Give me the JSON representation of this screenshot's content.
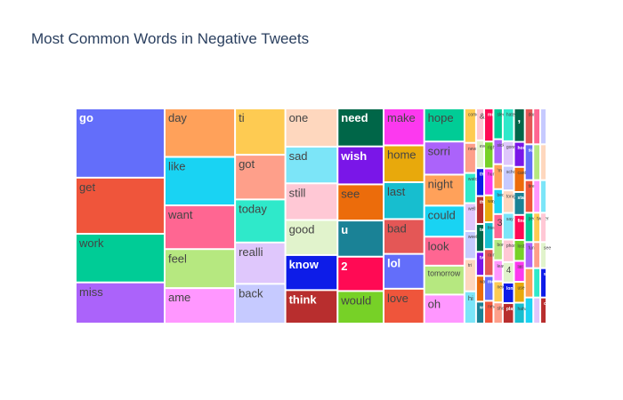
{
  "chart_data": {
    "type": "treemap",
    "title": "Most Common Words in Negative Tweets",
    "columns": [
      {
        "words": [
          "go",
          "get",
          "work",
          "miss"
        ],
        "values": [
          74,
          60,
          52,
          44
        ]
      },
      {
        "words": [
          "day",
          "like",
          "want",
          "feel",
          "ame"
        ],
        "values": [
          41,
          41,
          37,
          33,
          30
        ]
      },
      {
        "words": [
          "ti",
          "got",
          "today",
          "realli",
          "back"
        ],
        "values": [
          28,
          27,
          26,
          25,
          24
        ]
      },
      {
        "words": [
          "one",
          "sad",
          "still",
          "good",
          "know",
          "think"
        ],
        "values": [
          24,
          23,
          23,
          22,
          22,
          21
        ]
      },
      {
        "words": [
          "need",
          "wish",
          "see",
          "u",
          "2",
          "would"
        ],
        "values": [
          21,
          21,
          20,
          20,
          19,
          18
        ]
      },
      {
        "words": [
          "make",
          "home",
          "last",
          "bad",
          "lol",
          "love"
        ],
        "values": [
          18,
          18,
          18,
          17,
          17,
          17
        ]
      },
      {
        "words": [
          "hope",
          "sorri",
          "night",
          "could",
          "look",
          "tomorrow",
          "oh"
        ],
        "values": [
          16,
          16,
          15,
          15,
          14,
          14,
          14
        ]
      }
    ],
    "grid": {
      "col_values": [
        30,
        21,
        24,
        24,
        29,
        28,
        22,
        18,
        16
      ],
      "cells": [
        [
          {
            "w": "come",
            "v": 8
          },
          {
            "w": "new",
            "v": 7
          },
          {
            "w": "watch",
            "v": 7
          },
          {
            "w": "well",
            "v": 6.5
          },
          {
            "w": "week",
            "v": 6.5
          },
          {
            "w": "tri",
            "v": 7.5
          },
          {
            "w": "hi",
            "v": 7.5
          }
        ],
        [
          {
            "w": "&",
            "v": 8
          },
          {
            "w": "even",
            "v": 7
          },
          {
            "w": "thing",
            "v": 7
          },
          {
            "w": "though",
            "v": 7
          },
          {
            "w": "take",
            "v": 7
          },
          {
            "w": "twitter",
            "v": 6
          },
          {
            "w": "wait",
            "v": 6.5
          },
          {
            "w": "wanna",
            "v": 5.5
          }
        ],
        [
          {
            "w": "much",
            "v": 8
          },
          {
            "w": "right",
            "v": 6.5
          },
          {
            "w": "hurt",
            "v": 6.5
          },
          {
            "w": "way",
            "v": 6.5
          },
          {
            "w": "friend",
            "v": 6.5
          },
          {
            "w": "rain",
            "v": 6.5
          },
          {
            "w": "morn",
            "v": 6
          },
          {
            "w": "never",
            "v": 5.5
          }
        ],
        [
          {
            "w": "sleep",
            "v": 8
          },
          {
            "w": "sick",
            "v": 6.5
          },
          {
            "w": "'m",
            "v": 6.5
          },
          {
            "w": "bed",
            "v": 6.5
          },
          {
            "w": "3",
            "v": 6.5
          },
          {
            "w": "bore",
            "v": 5.5
          },
          {
            "w": "leav",
            "v": 5.5
          },
          {
            "w": "next",
            "v": 5.5
          },
          {
            "w": "show",
            "v": 5.5
          }
        ],
        [
          {
            "w": "hate",
            "v": 8
          },
          {
            "w": "gonna",
            "v": 6
          },
          {
            "w": "school",
            "v": 6
          },
          {
            "w": "tonight",
            "v": 5.5
          },
          {
            "w": "say",
            "v": 6.5
          },
          {
            "w": "phone",
            "v": 5.5
          },
          {
            "w": "4",
            "v": 5
          },
          {
            "w": "long",
            "v": 5
          },
          {
            "w": "play",
            "v": 5
          }
        ],
        [
          {
            "w": ",",
            "v": 8
          },
          {
            "w": "hour",
            "v": 6
          },
          {
            "w": "cant",
            "v": 6
          },
          {
            "w": "start",
            "v": 5.5
          },
          {
            "w": "find",
            "v": 6
          },
          {
            "w": "lost",
            "v": 5
          },
          {
            "w": "littl",
            "v": 5
          },
          {
            "w": "use",
            "v": 5
          },
          {
            "w": "haha",
            "v": 5
          }
        ],
        [
          {
            "w": "dont",
            "v": 5.5
          },
          {
            "w": "suck",
            "v": 5.5
          },
          {
            "w": "tire",
            "v": 5
          },
          {
            "w": "peopl",
            "v": 4.5
          },
          {
            "w": "fun",
            "v": 4
          },
          {
            "w": "",
            "v": 4.5
          },
          {
            "w": "",
            "v": 4
          }
        ],
        [
          {
            "w": "",
            "v": 5.5
          },
          {
            "w": "",
            "v": 5.5
          },
          {
            "w": "",
            "v": 5
          },
          {
            "w": "twitter",
            "v": 4.5
          },
          {
            "w": "",
            "v": 4
          },
          {
            "w": "",
            "v": 4.5
          },
          {
            "w": "",
            "v": 4
          }
        ],
        [
          {
            "w": "",
            "v": 5.5
          },
          {
            "w": "",
            "v": 5.5
          },
          {
            "w": "",
            "v": 5
          },
          {
            "w": "",
            "v": 4.5
          },
          {
            "w": "see",
            "v": 4
          },
          {
            "w": "wo",
            "v": 4.5
          },
          {
            "w": "cal",
            "v": 4
          }
        ]
      ]
    },
    "palette": [
      "#636efa",
      "#ef553b",
      "#00cc96",
      "#ab63fa",
      "#ffa15a",
      "#19d3f3",
      "#ff6692",
      "#b6e880",
      "#ff97ff",
      "#fecb52",
      "#fe9f8a",
      "#2fe9ca",
      "#dfc7fc",
      "#c6caff",
      "#fed7be",
      "#7ce5f8",
      "#ffc8d5",
      "#e1f3cc",
      "#0d1ce8",
      "#b82e2e",
      "#006648",
      "#7a16e8",
      "#ec6c0b",
      "#1a8296",
      "#ff0a54",
      "#77d127",
      "#fc39ef",
      "#e8a90c",
      "#17becf",
      "#e45756"
    ],
    "text_colors": {
      "dark": "#444444",
      "light": "#ffffff"
    }
  }
}
